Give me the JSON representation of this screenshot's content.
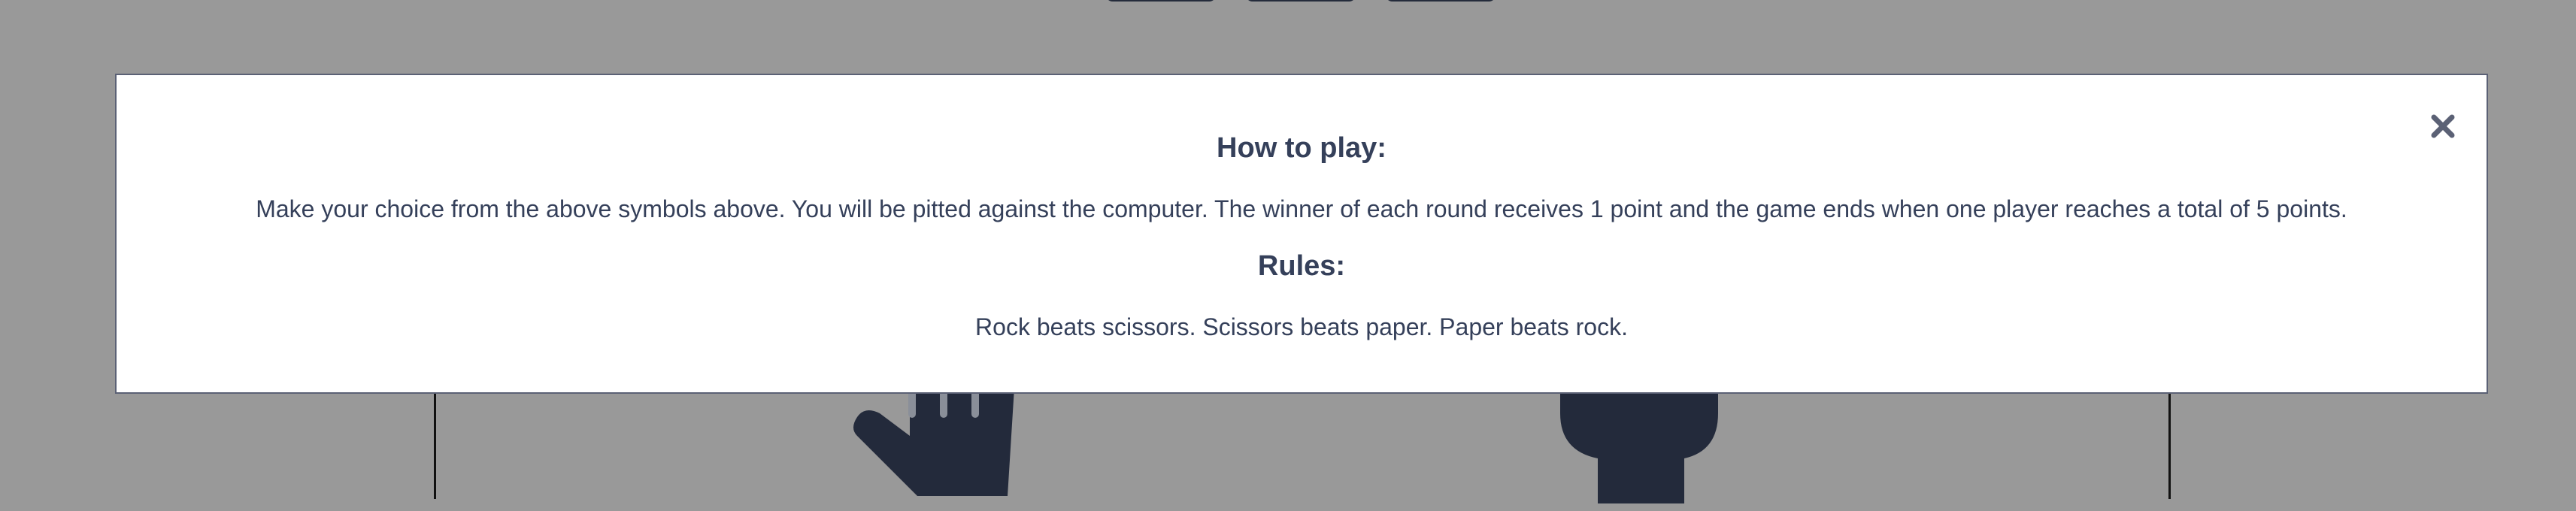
{
  "modal": {
    "how_to_play_heading": "How to play:",
    "how_to_play_text": "Make your choice from the above symbols above. You will be pitted against the computer. The winner of each round receives 1 point and the game ends when one player reaches a total of 5 points.",
    "rules_heading": "Rules:",
    "rules_text": "Rock beats scissors. Scissors beats paper. Paper beats rock."
  },
  "icons": {
    "close": "close-icon",
    "player_hand": "hand-paper-icon",
    "computer_hand": "hand-rock-icon"
  },
  "colors": {
    "overlay": "#999999",
    "modal_bg": "#ffffff",
    "text": "#35405a",
    "icon_dark": "#232a3b"
  }
}
